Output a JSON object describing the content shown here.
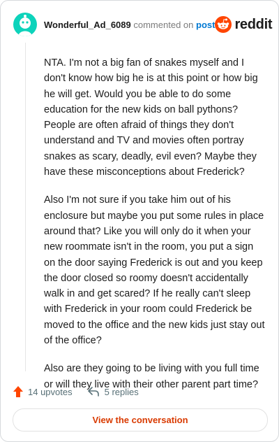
{
  "header": {
    "username": "Wonderful_Ad_6089",
    "commented_text": "commented on",
    "post_link": "post",
    "brand": "reddit"
  },
  "comment": {
    "paragraphs": [
      "NTA. I'm not a big fan of snakes myself and I don't know how big he is at this point or how big he will get. Would you be able to do some education for the new kids on ball pythons? People are often afraid of things they don't understand and TV and movies often portray snakes as scary, deadly, evil even? Maybe they have these misconceptions about Frederick?",
      "Also I'm not sure if you take him out of his enclosure but maybe you put some rules in place around that? Like you will only do it when your new roommate isn't in the room, you put a sign on the door saying Frederick is out and you keep the door closed so roomy doesn't accidentally walk in and get scared? If he really can't sleep with Frederick in your room could Frederick be moved to the office and the new kids just stay out of the office?",
      "Also are they going to be living with you full time or will they live with their other parent part time?"
    ]
  },
  "actions": {
    "upvotes_label": "14 upvotes",
    "replies_label": "5 replies"
  },
  "footer": {
    "view_button_label": "View the conversation"
  },
  "colors": {
    "avatar_bg": "#0dd3bb",
    "reddit_orange": "#ff4500",
    "link_blue": "#0079d3",
    "upvote_orange": "#ff4500",
    "button_text": "#d93a00"
  },
  "icons": {
    "avatar": "snoo-avatar-icon",
    "brand": "reddit-logo-icon",
    "upvote": "upvote-arrow-icon",
    "reply": "reply-arrow-icon"
  }
}
